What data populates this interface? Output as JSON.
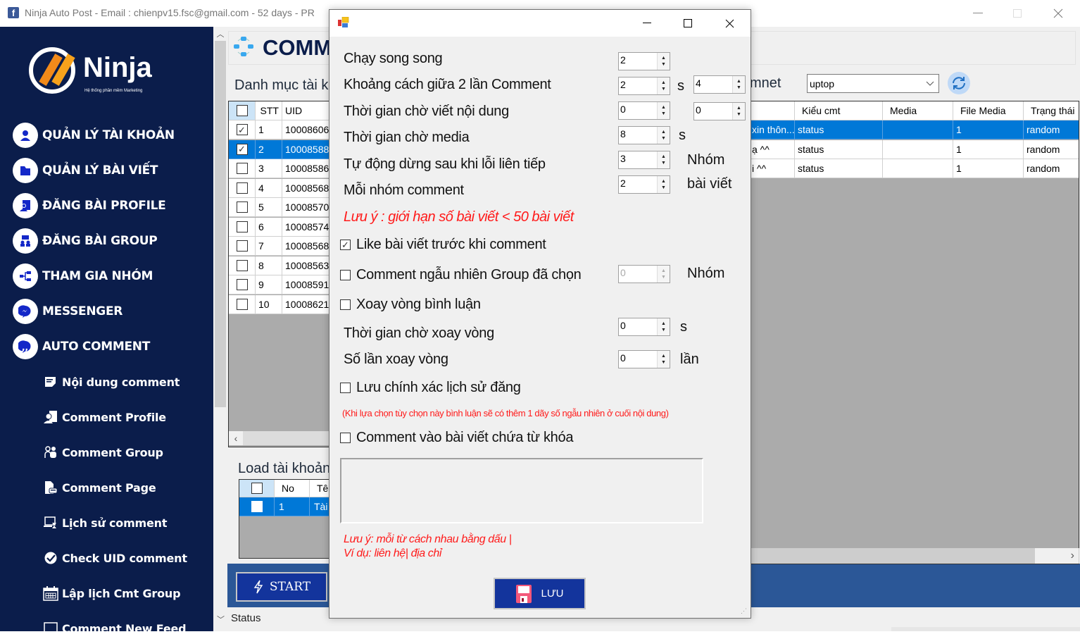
{
  "window": {
    "title": "Ninja Auto Post - Email : chienpv15.fsc@gmail.com - 52 days -  PR",
    "icon": "facebook-f-icon"
  },
  "sidebar": {
    "logo_text": "Ninja",
    "logo_tagline": "Hệ thống phần mềm Marketing",
    "items": [
      {
        "label": "QUẢN LÝ TÀI KHOẢN",
        "icon": "user-icon"
      },
      {
        "label": "QUẢN LÝ BÀI VIẾT",
        "icon": "folder-icon"
      },
      {
        "label": "ĐĂNG BÀI PROFILE",
        "icon": "profile-post-icon"
      },
      {
        "label": "ĐĂNG BÀI GROUP",
        "icon": "group-icon"
      },
      {
        "label": "THAM GIA NHÓM",
        "icon": "network-icon"
      },
      {
        "label": "MESSENGER",
        "icon": "messenger-icon"
      },
      {
        "label": "AUTO COMMENT",
        "icon": "quote-bubble-icon"
      }
    ],
    "sub_items": [
      {
        "label": "Nội dung comment",
        "icon": "note-icon"
      },
      {
        "label": "Comment Profile",
        "icon": "person-doc-icon"
      },
      {
        "label": "Comment Group",
        "icon": "people-icon"
      },
      {
        "label": "Comment Page",
        "icon": "page-icon"
      },
      {
        "label": "Lịch sử comment",
        "icon": "history-icon"
      },
      {
        "label": "Check UID comment",
        "icon": "check-circle-icon"
      },
      {
        "label": "Lập lịch Cmt Group",
        "icon": "calendar-icon"
      },
      {
        "label": "Comment New Feed",
        "icon": "feed-icon"
      }
    ]
  },
  "main": {
    "page_title": "COMM",
    "account_section_label": "Danh mục tài kh",
    "account_table": {
      "columns": [
        "",
        "STT",
        "UID"
      ],
      "rows": [
        {
          "checked": true,
          "stt": "1",
          "uid": "10008606"
        },
        {
          "checked": true,
          "stt": "2",
          "uid": "10008588",
          "selected": true
        },
        {
          "checked": false,
          "stt": "3",
          "uid": "10008586"
        },
        {
          "checked": false,
          "stt": "4",
          "uid": "10008568"
        },
        {
          "checked": false,
          "stt": "5",
          "uid": "10008570"
        },
        {
          "checked": false,
          "stt": "6",
          "uid": "10008574"
        },
        {
          "checked": false,
          "stt": "7",
          "uid": "10008568"
        },
        {
          "checked": false,
          "stt": "8",
          "uid": "10008563"
        },
        {
          "checked": false,
          "stt": "9",
          "uid": "10008591"
        },
        {
          "checked": false,
          "stt": "10",
          "uid": "10008621"
        }
      ]
    },
    "load_section_label": "Load tài khoản",
    "load_table": {
      "columns": [
        "",
        "No",
        "Tê"
      ],
      "rows": [
        {
          "checked": false,
          "no": "1",
          "name": "Tài",
          "selected": true
        }
      ]
    },
    "start_label": "START",
    "status_label": "Status",
    "comment_label": "mnet",
    "comment_select_value": "uptop",
    "comment_table": {
      "columns": [
        "",
        "Kiểu cmt",
        "Media",
        "File Media",
        "Trạng thái"
      ],
      "rows": [
        {
          "content": "xin thôn...",
          "type": "status",
          "media": "",
          "file_media": "1",
          "status": "random",
          "selected": true
        },
        {
          "content": "ạ ^^",
          "type": "status",
          "media": "",
          "file_media": "1",
          "status": "random"
        },
        {
          "content": "i ^^",
          "type": "status",
          "media": "",
          "file_media": "1",
          "status": "random"
        }
      ]
    }
  },
  "dialog": {
    "fields": {
      "parallel": {
        "label": "Chạy song song",
        "value": "2"
      },
      "interval": {
        "label": "Khoảng cách giữa 2 lần Comment",
        "min": "2",
        "unit": "s",
        "max": "4"
      },
      "write_wait": {
        "label": "Thời gian chờ viết nội dung",
        "min": "0",
        "max": "0"
      },
      "media_wait": {
        "label": "Thời gian chờ media",
        "value": "8",
        "unit": "s"
      },
      "auto_stop": {
        "label": "Tự động dừng sau khi lỗi liên tiếp",
        "value": "3",
        "unit": "Nhóm"
      },
      "per_group": {
        "label": "Mỗi nhóm comment",
        "value": "2",
        "unit": "bài viết"
      }
    },
    "limit_note": "Lưu ý : giới hạn số bài viết < 50 bài viết",
    "like_before": {
      "label": "Like bài viết trước khi comment",
      "checked": true
    },
    "random_group": {
      "label": "Comment ngẫu nhiên Group đã chọn",
      "checked": false,
      "value": "0",
      "unit": "Nhóm"
    },
    "rotate": {
      "label": "Xoay vòng bình luận",
      "checked": false
    },
    "rotate_wait": {
      "label": "Thời gian chờ xoay vòng",
      "value": "0",
      "unit": "s"
    },
    "rotate_count": {
      "label": "Số lần xoay vòng",
      "value": "0",
      "unit": "lần"
    },
    "exact_history": {
      "label": "Lưu chính xác lịch sử đăng",
      "checked": false
    },
    "history_note": "(Khi lựa chọn tùy chọn này bình luận sẽ có thêm 1 dãy số ngẫu nhiên ở cuối nội dung)",
    "keyword": {
      "label": "Comment vào bài viết chứa từ khóa",
      "checked": false,
      "value": ""
    },
    "keyword_note_1": "Lưu ý: mỗi từ cách nhau bằng dấu |",
    "keyword_note_2": "Ví dụ: liên hệ| địa chỉ",
    "save_label": "LƯU"
  },
  "colors": {
    "sidebar_bg": "#0b1d4b",
    "accent_blue": "#13349c",
    "selection": "#0078d7",
    "panel_blue": "#2b5797",
    "note_red": "#ff1a1a"
  }
}
